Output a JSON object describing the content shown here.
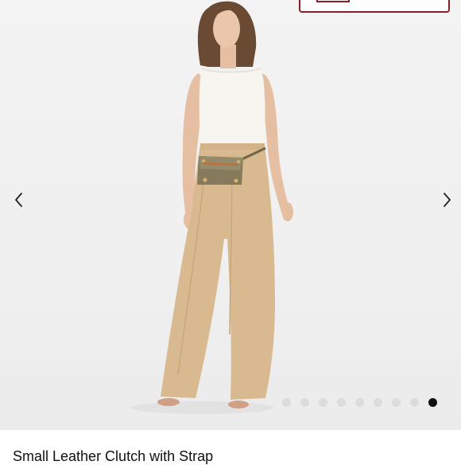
{
  "product": {
    "title": "Small Leather Clutch with Strap"
  },
  "carousel": {
    "photo_subject": "model in white sleeveless top and beige wide-leg trousers wearing olive leather clutch as belt bag",
    "prev_icon": "chevron-left-icon",
    "next_icon": "chevron-right-icon",
    "slide_count": 9,
    "active_index": 8
  },
  "colors": {
    "badge_border": "#8a1f2c",
    "dot_inactive": "#dcdcdc",
    "dot_active": "#111111",
    "text": "#111111"
  }
}
